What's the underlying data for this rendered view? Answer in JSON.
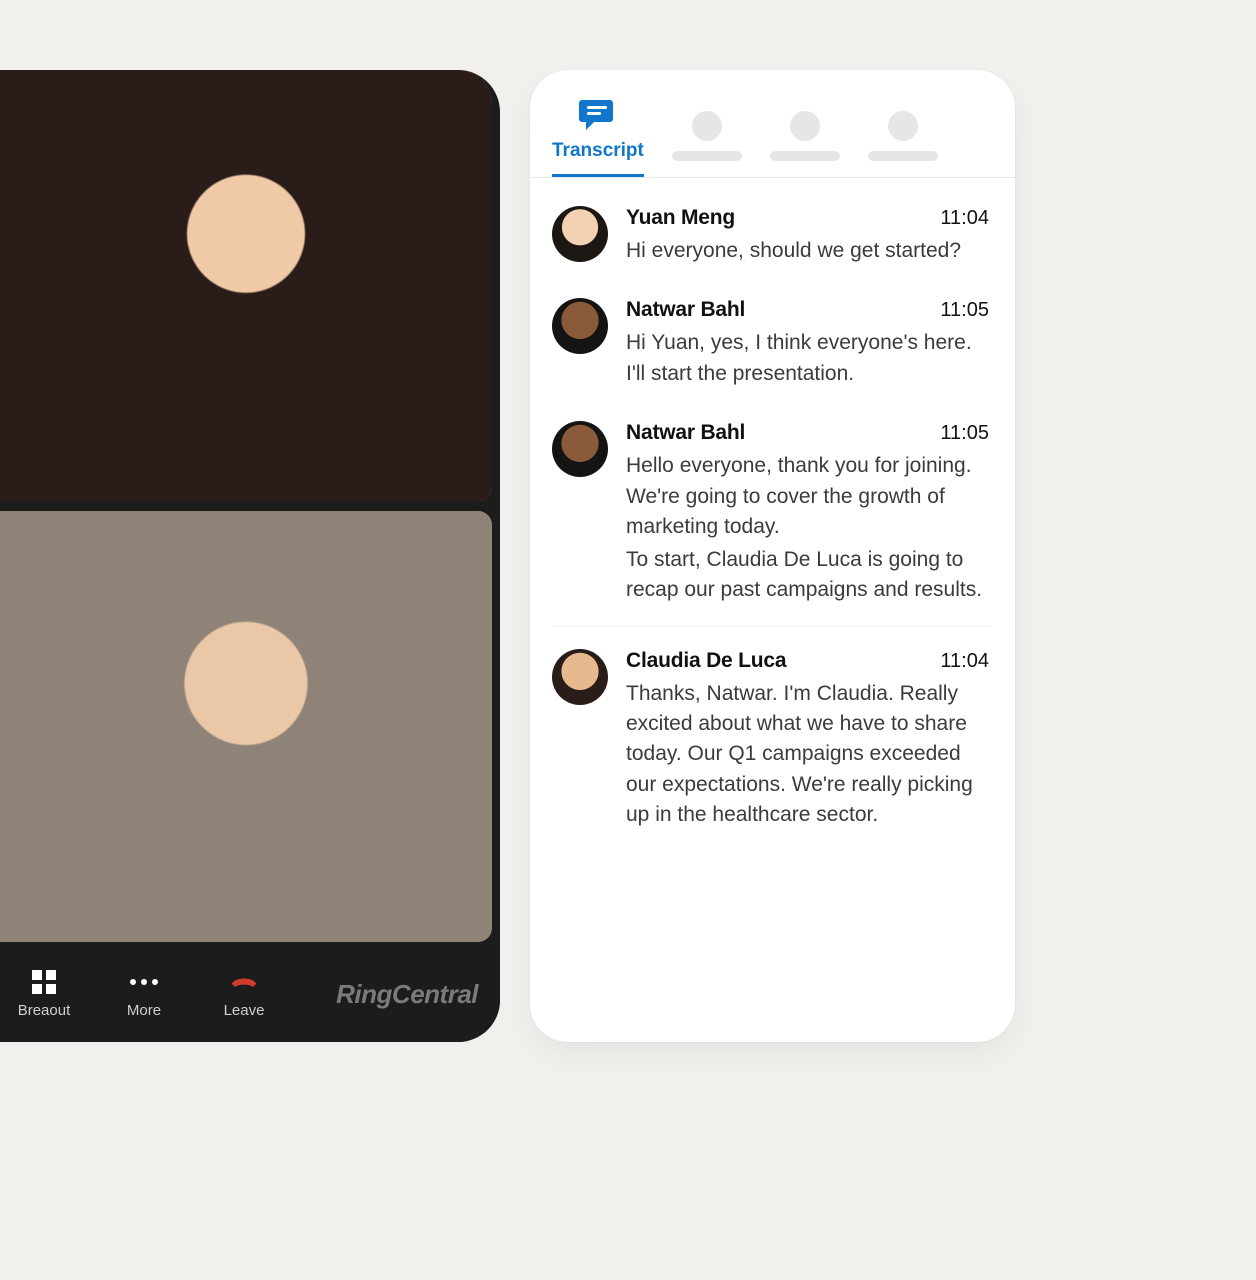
{
  "call": {
    "controls": {
      "breakout_label": "Breaout",
      "more_label": "More",
      "leave_label": "Leave"
    },
    "brand": "RingCentral"
  },
  "transcript": {
    "tabs": {
      "active_label": "Transcript"
    },
    "messages": [
      {
        "name": "Yuan Meng",
        "time": "11:04",
        "text": "Hi everyone, should we get started?"
      },
      {
        "name": "Natwar Bahl",
        "time": "11:05",
        "text": "Hi Yuan, yes, I think everyone's here. I'll start the presentation."
      },
      {
        "name": "Natwar Bahl",
        "time": "11:05",
        "text_p1": "Hello everyone, thank you for joining. We're going to cover the growth of marketing today.",
        "text_p2": "To start, Claudia De Luca is going to recap our past campaigns and results."
      },
      {
        "name": "Claudia De Luca",
        "time": "11:04",
        "text": "Thanks, Natwar. I'm Claudia. Really excited about what we have to share today. Our Q1 campaigns exceeded our expectations. We're really picking up in the healthcare sector."
      }
    ]
  }
}
